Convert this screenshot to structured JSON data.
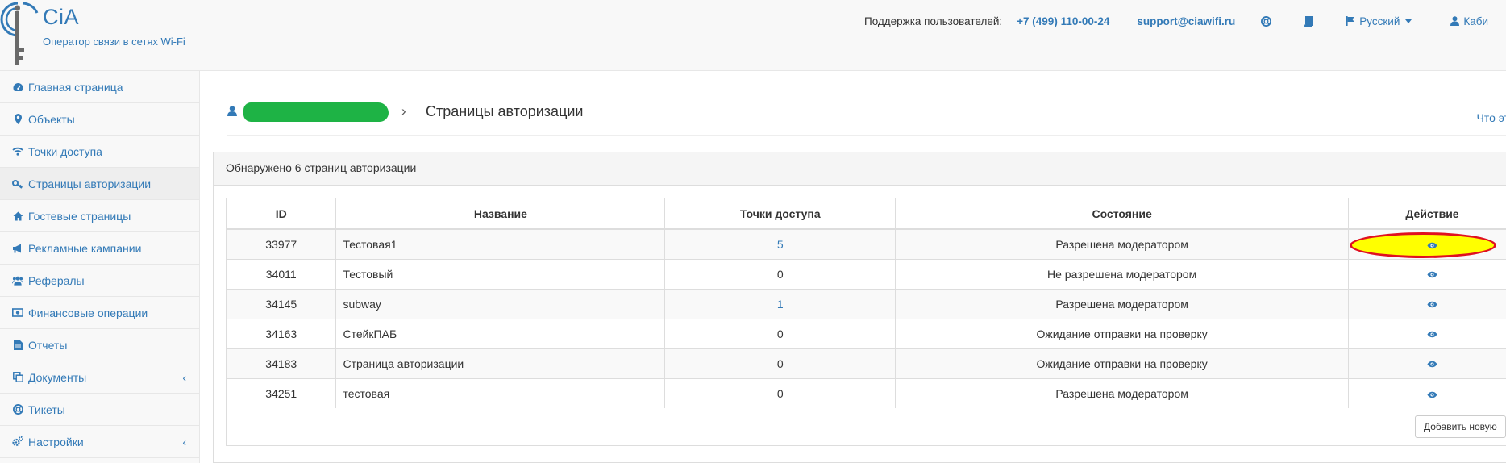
{
  "header": {
    "brand": "CiA",
    "slogan": "Оператор связи в сетях Wi-Fi",
    "support_label": "Поддержка пользователей:",
    "phone": "+7 (499) 110-00-24",
    "email": "support@ciawifi.ru",
    "language": "Русский",
    "cabinet": "Каби"
  },
  "sidebar": {
    "items": [
      {
        "label": "Главная страница",
        "icon": "dashboard-icon"
      },
      {
        "label": "Объекты",
        "icon": "map-marker-icon"
      },
      {
        "label": "Точки доступа",
        "icon": "wifi-icon"
      },
      {
        "label": "Страницы авторизации",
        "icon": "key-icon",
        "active": true
      },
      {
        "label": "Гостевые страницы",
        "icon": "home-icon"
      },
      {
        "label": "Рекламные кампании",
        "icon": "bullhorn-icon"
      },
      {
        "label": "Рефералы",
        "icon": "users-icon"
      },
      {
        "label": "Финансовые операции",
        "icon": "money-icon"
      },
      {
        "label": "Отчеты",
        "icon": "file-icon"
      },
      {
        "label": "Документы",
        "icon": "copy-icon",
        "submenu": true
      },
      {
        "label": "Тикеты",
        "icon": "lifebuoy-icon"
      },
      {
        "label": "Настройки",
        "icon": "cogs-icon",
        "submenu": true
      }
    ]
  },
  "breadcrumb": {
    "current": "Страницы авторизации",
    "help_link": "Что эт"
  },
  "panel": {
    "heading": "Обнаружено 6 страниц авторизации",
    "columns": [
      "ID",
      "Название",
      "Точки доступа",
      "Состояние",
      "Действие"
    ],
    "rows": [
      {
        "id": "33977",
        "name": "Тестовая1",
        "aps": "5",
        "aps_link": true,
        "state": "Разрешена модератором",
        "highlighted": true
      },
      {
        "id": "34011",
        "name": "Тестовый",
        "aps": "0",
        "aps_link": false,
        "state": "Не разрешена модератором"
      },
      {
        "id": "34145",
        "name": "subway",
        "aps": "1",
        "aps_link": true,
        "state": "Разрешена модератором"
      },
      {
        "id": "34163",
        "name": "СтейкПАБ",
        "aps": "0",
        "aps_link": false,
        "state": "Ожидание отправки на проверку"
      },
      {
        "id": "34183",
        "name": "Страница авторизации",
        "aps": "0",
        "aps_link": false,
        "state": "Ожидание отправки на проверку"
      },
      {
        "id": "34251",
        "name": "тестовая",
        "aps": "0",
        "aps_link": false,
        "state": "Разрешена модератором"
      }
    ],
    "add_button": "Добавить новую"
  },
  "colors": {
    "link": "#337ab7",
    "highlight_fill": "#ffff00",
    "highlight_stroke": "#e01020",
    "redaction": "#1eb345"
  }
}
